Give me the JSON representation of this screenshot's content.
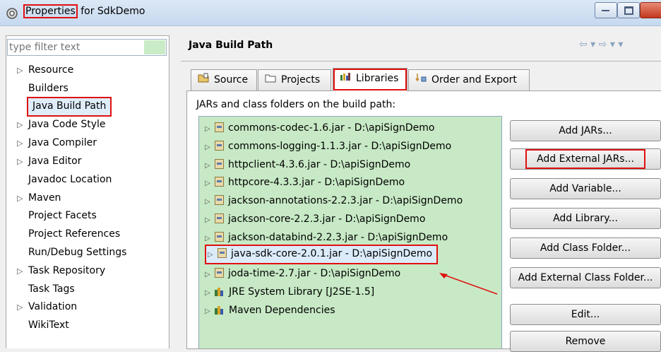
{
  "window": {
    "title_prefix": "Properties",
    "title_suffix": " for SdkDemo"
  },
  "filter": {
    "placeholder": "type filter text"
  },
  "tree": [
    {
      "label": "Resource",
      "expandable": true
    },
    {
      "label": "Builders",
      "expandable": false
    },
    {
      "label": "Java Build Path",
      "expandable": false,
      "selected": true
    },
    {
      "label": "Java Code Style",
      "expandable": true
    },
    {
      "label": "Java Compiler",
      "expandable": true
    },
    {
      "label": "Java Editor",
      "expandable": true
    },
    {
      "label": "Javadoc Location",
      "expandable": false
    },
    {
      "label": "Maven",
      "expandable": true
    },
    {
      "label": "Project Facets",
      "expandable": false
    },
    {
      "label": "Project References",
      "expandable": false
    },
    {
      "label": "Run/Debug Settings",
      "expandable": false
    },
    {
      "label": "Task Repository",
      "expandable": true
    },
    {
      "label": "Task Tags",
      "expandable": false
    },
    {
      "label": "Validation",
      "expandable": true
    },
    {
      "label": "WikiText",
      "expandable": false
    }
  ],
  "page": {
    "title": "Java Build Path",
    "nav": "⇦ ▾ ⇨ ▾ ▾"
  },
  "tabs": [
    {
      "label": "Source",
      "icon": "source-folder-icon"
    },
    {
      "label": "Projects",
      "icon": "projects-folder-icon"
    },
    {
      "label": "Libraries",
      "icon": "libraries-icon",
      "active": true
    },
    {
      "label": "Order and Export",
      "icon": "order-export-icon"
    }
  ],
  "libraries": {
    "caption": "JARs and class folders on the build path:",
    "items": [
      {
        "label": "commons-codec-1.6.jar - D:\\apiSignDemo",
        "icon": "jar-icon"
      },
      {
        "label": "commons-logging-1.1.3.jar - D:\\apiSignDemo",
        "icon": "jar-icon"
      },
      {
        "label": "httpclient-4.3.6.jar - D:\\apiSignDemo",
        "icon": "jar-icon"
      },
      {
        "label": "httpcore-4.3.3.jar - D:\\apiSignDemo",
        "icon": "jar-icon"
      },
      {
        "label": "jackson-annotations-2.2.3.jar - D:\\apiSignDemo",
        "icon": "jar-icon"
      },
      {
        "label": "jackson-core-2.2.3.jar - D:\\apiSignDemo",
        "icon": "jar-icon"
      },
      {
        "label": "jackson-databind-2.2.3.jar - D:\\apiSignDemo",
        "icon": "jar-icon"
      },
      {
        "label": "java-sdk-core-2.0.1.jar - D:\\apiSignDemo",
        "icon": "jar-icon",
        "selected": true
      },
      {
        "label": "joda-time-2.7.jar - D:\\apiSignDemo",
        "icon": "jar-icon"
      },
      {
        "label": "JRE System Library [J2SE-1.5]",
        "icon": "library-icon"
      },
      {
        "label": "Maven Dependencies",
        "icon": "library-icon"
      }
    ]
  },
  "buttons": [
    {
      "label": "Add JARs..."
    },
    {
      "label": "Add External JARs...",
      "highlighted": true
    },
    {
      "label": "Add Variable..."
    },
    {
      "label": "Add Library..."
    },
    {
      "label": "Add Class Folder..."
    },
    {
      "label": "Add External Class Folder..."
    },
    {
      "label": "Edit..."
    },
    {
      "label": "Remove"
    }
  ],
  "colors": {
    "highlight_red": "#e01010",
    "list_bg": "#c7e9c5",
    "selection_bg": "#dcebfa"
  }
}
